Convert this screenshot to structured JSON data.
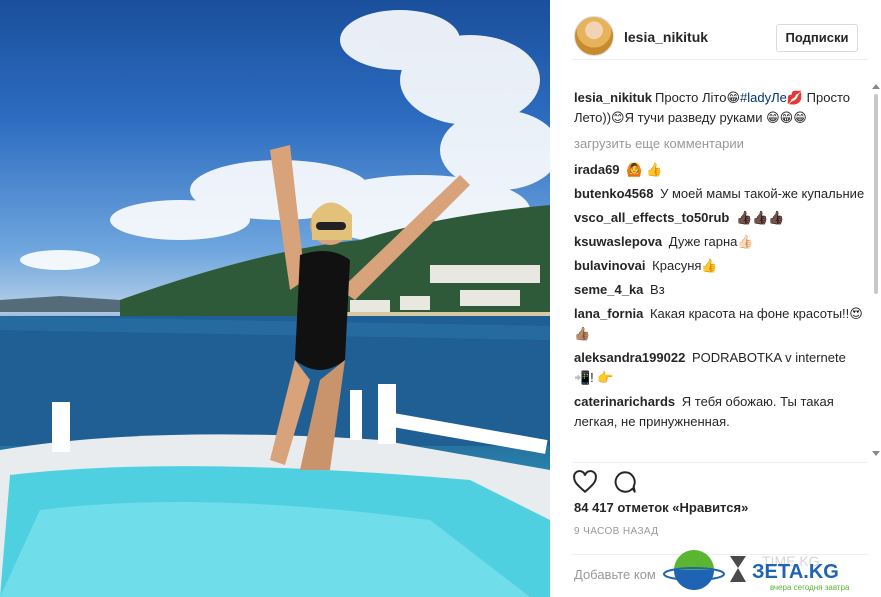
{
  "post": {
    "username": "lesia_nikituk",
    "follow_label": "Подписки",
    "caption_user": "lesia_nikituk",
    "caption_part1": "Просто Літо😁",
    "caption_hashtag": "#ladyЛе",
    "caption_part2": "💋 Просто Лето))😊Я тучи разведу руками 😁😁😁",
    "load_more": "загрузить еще комментарии",
    "likes": "84 417 отметок «Нравится»",
    "timestamp": "9 ЧАСОВ НАЗАД",
    "add_comment_placeholder": "Добавьте ком"
  },
  "comments": [
    {
      "user": "irada69",
      "text": "🙆 👍"
    },
    {
      "user": "butenko4568",
      "text": "У моей мамы такой-же купальние"
    },
    {
      "user": "vsco_all_effects_to50rub",
      "text": "👍🏿👍🏿👍🏿"
    },
    {
      "user": "ksuwaslepova",
      "text": "Дуже гарна👍🏻"
    },
    {
      "user": "bulavinovai",
      "text": "Красуня👍"
    },
    {
      "user": "seme_4_ka",
      "text": "Вз"
    },
    {
      "user": "lana_fornia",
      "text": "Какая красота на фоне красоты!!😍👍🏽"
    },
    {
      "user": "aleksandra199022",
      "text": "PODRABOTKA v internete 📲! 👉"
    },
    {
      "user": "caterinarichards",
      "text": "Я тебя обожаю. Ты такая легкая, не принужненная."
    }
  ],
  "watermark": {
    "brand": "ЗЕТА.KG",
    "tagline": "вчера сегодня завтра",
    "faded": "TIME.KG"
  },
  "colors": {
    "link": "#003569",
    "muted": "#999999",
    "brand_green": "#5bb531",
    "brand_blue": "#1f63b5"
  }
}
